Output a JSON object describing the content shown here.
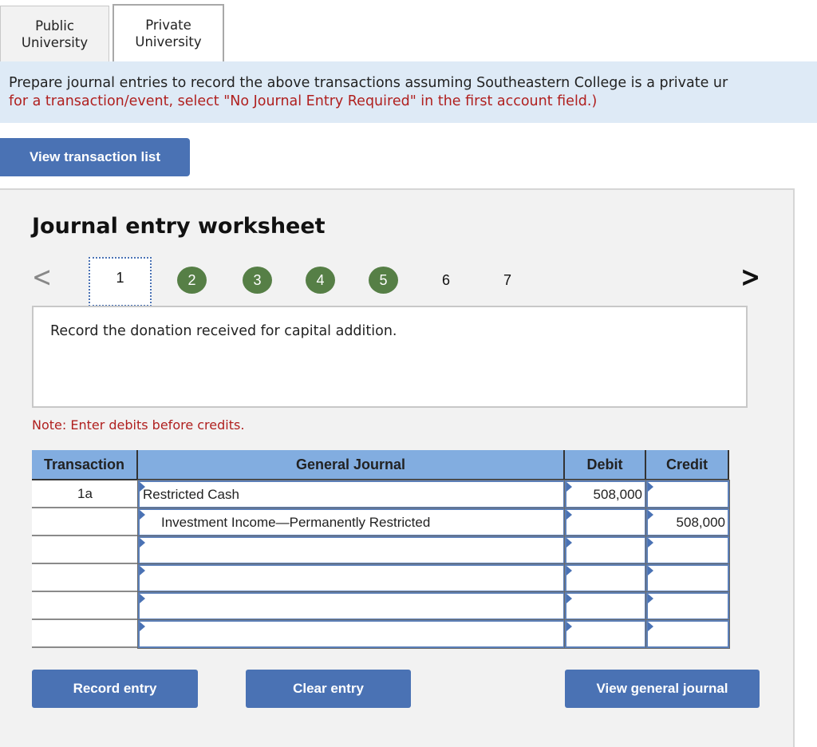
{
  "tabs": [
    {
      "label": "Public\nUniversity",
      "line1": "Public",
      "line2": "University",
      "active": false
    },
    {
      "label": "Private\nUniversity",
      "line1": "Private",
      "line2": "University",
      "active": true
    }
  ],
  "instruction": {
    "line1": "Prepare journal entries to record the above transactions assuming Southeastern College is a private ur",
    "line2": "for a transaction/event, select \"No Journal Entry Required\" in the first account field.)"
  },
  "buttons": {
    "view_transaction_list": "View transaction list",
    "record_entry": "Record entry",
    "clear_entry": "Clear entry",
    "view_general_journal": "View general journal"
  },
  "worksheet": {
    "title": "Journal entry worksheet",
    "pager": {
      "prev": "<",
      "next": ">",
      "current": "1",
      "completed": [
        "2",
        "3",
        "4",
        "5"
      ],
      "pending": [
        "6",
        "7"
      ]
    },
    "prompt": "Record the donation received for capital addition.",
    "note": "Note: Enter debits before credits."
  },
  "journal": {
    "headers": {
      "transaction": "Transaction",
      "general_journal": "General Journal",
      "debit": "Debit",
      "credit": "Credit"
    },
    "rows": [
      {
        "transaction": "1a",
        "account": "Restricted Cash",
        "debit": "508,000",
        "credit": ""
      },
      {
        "transaction": "",
        "account": "Investment Income—Permanently Restricted",
        "debit": "",
        "credit": "508,000"
      },
      {
        "transaction": "",
        "account": "",
        "debit": "",
        "credit": ""
      },
      {
        "transaction": "",
        "account": "",
        "debit": "",
        "credit": ""
      },
      {
        "transaction": "",
        "account": "",
        "debit": "",
        "credit": ""
      },
      {
        "transaction": "",
        "account": "",
        "debit": "",
        "credit": ""
      }
    ]
  },
  "colors": {
    "accent_button": "#4a72b4",
    "completed_step": "#567f46",
    "header_blue": "#82ade0",
    "instruction_bg": "#deeaf6",
    "warning_red": "#b0201f"
  }
}
